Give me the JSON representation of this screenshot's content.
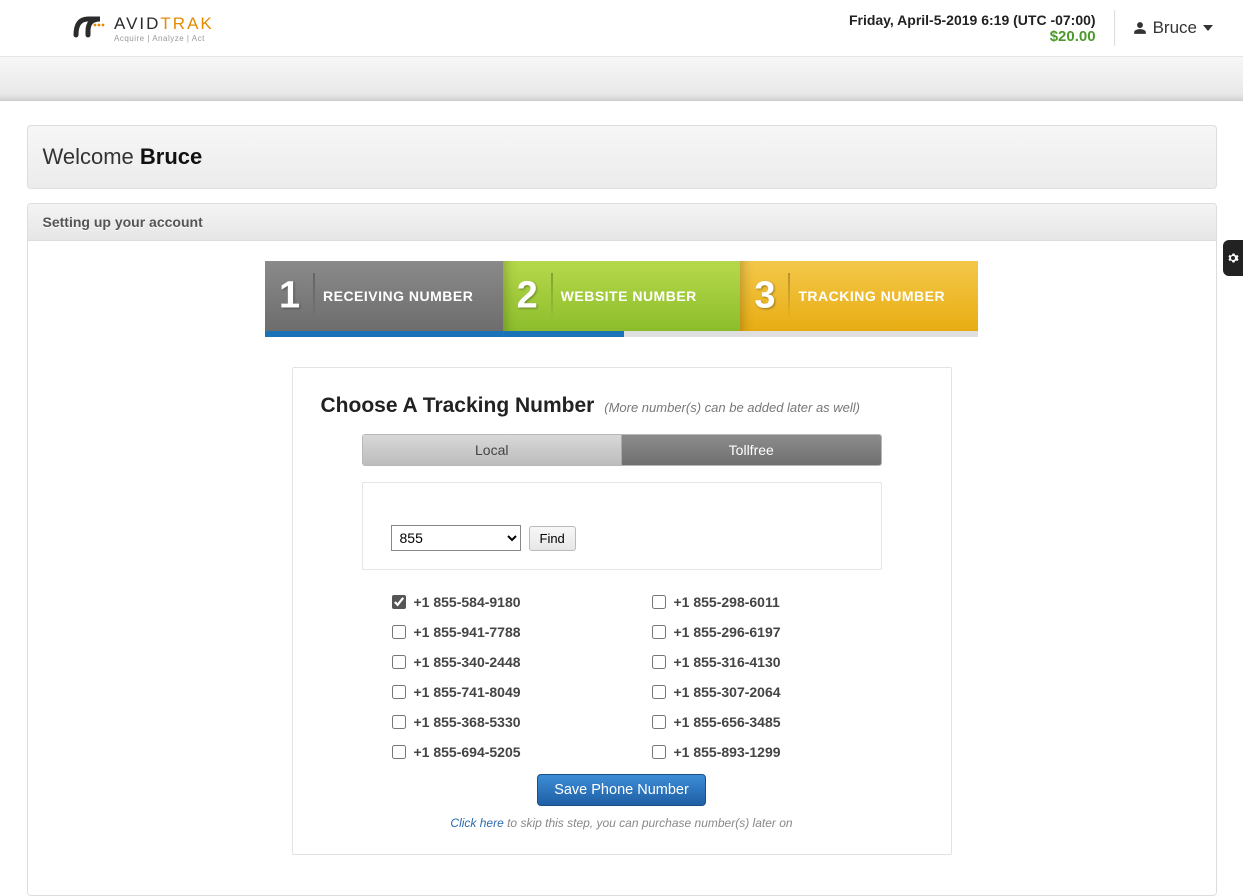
{
  "header": {
    "brand_primary": "AVID",
    "brand_secondary": "TRAK",
    "tagline": "Acquire  |  Analyze  |  Act",
    "datetime": "Friday, April-5-2019 6:19 (UTC -07:00)",
    "balance": "$20.00",
    "username": "Bruce"
  },
  "welcome": {
    "prefix": "Welcome ",
    "username": "Bruce"
  },
  "setup": {
    "heading": "Setting up your account",
    "steps": [
      {
        "num": "1",
        "label": "RECEIVING NUMBER"
      },
      {
        "num": "2",
        "label": "WEBSITE NUMBER"
      },
      {
        "num": "3",
        "label": "TRACKING NUMBER"
      }
    ],
    "card": {
      "title": "Choose A Tracking Number",
      "subtitle": "(More number(s) can be added later as well)",
      "tabs": {
        "local": "Local",
        "tollfree": "Tollfree",
        "active": "tollfree"
      },
      "prefix_selected": "855",
      "find_label": "Find",
      "numbers_left": [
        {
          "value": "+1 855-584-9180",
          "checked": true
        },
        {
          "value": "+1 855-941-7788",
          "checked": false
        },
        {
          "value": "+1 855-340-2448",
          "checked": false
        },
        {
          "value": "+1 855-741-8049",
          "checked": false
        },
        {
          "value": "+1 855-368-5330",
          "checked": false
        },
        {
          "value": "+1 855-694-5205",
          "checked": false
        }
      ],
      "numbers_right": [
        {
          "value": "+1 855-298-6011",
          "checked": false
        },
        {
          "value": "+1 855-296-6197",
          "checked": false
        },
        {
          "value": "+1 855-316-4130",
          "checked": false
        },
        {
          "value": "+1 855-307-2064",
          "checked": false
        },
        {
          "value": "+1 855-656-3485",
          "checked": false
        },
        {
          "value": "+1 855-893-1299",
          "checked": false
        }
      ],
      "save_label": "Save Phone Number",
      "skip_link": "Click here",
      "skip_text": " to skip this step, you can purchase number(s) later on"
    }
  }
}
